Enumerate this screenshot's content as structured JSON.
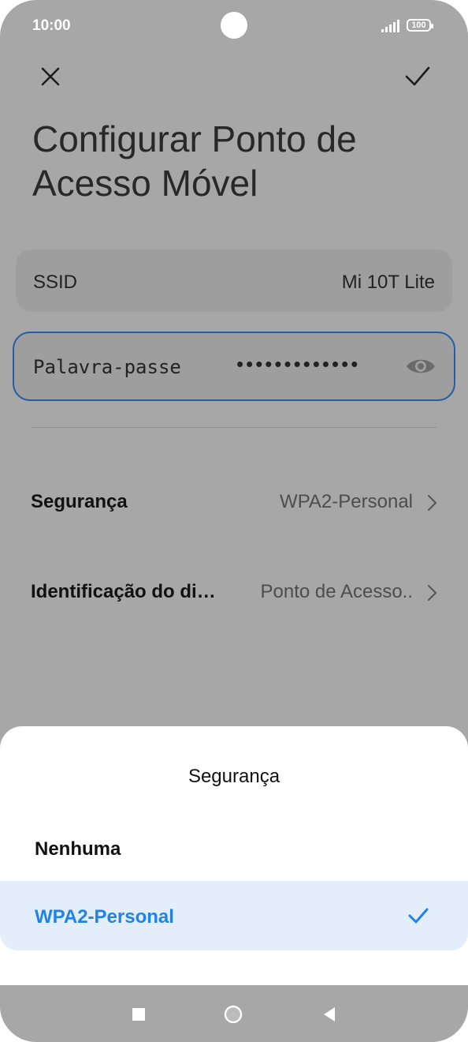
{
  "status_bar": {
    "time": "10:00",
    "battery": "100"
  },
  "header": {
    "close_icon": "close-icon",
    "confirm_icon": "check-icon",
    "title": "Configurar Ponto de Acesso Móvel"
  },
  "form": {
    "ssid_label": "SSID",
    "ssid_value": "Mi 10T Lite",
    "password_label": "Palavra-passe",
    "password_mask": "•••••••••••••",
    "security_label": "Segurança",
    "security_value": "WPA2-Personal",
    "device_id_label": "Identificação do di…",
    "device_id_value": "Ponto de Acesso.."
  },
  "sheet": {
    "title": "Segurança",
    "options": [
      {
        "label": "Nenhuma",
        "selected": false
      },
      {
        "label": "WPA2-Personal",
        "selected": true
      }
    ]
  },
  "colors": {
    "accent": "#2282e6",
    "selected_background": "#e3eefa",
    "focus_border": "#245ea8",
    "scrim": "#a7a7a7"
  }
}
